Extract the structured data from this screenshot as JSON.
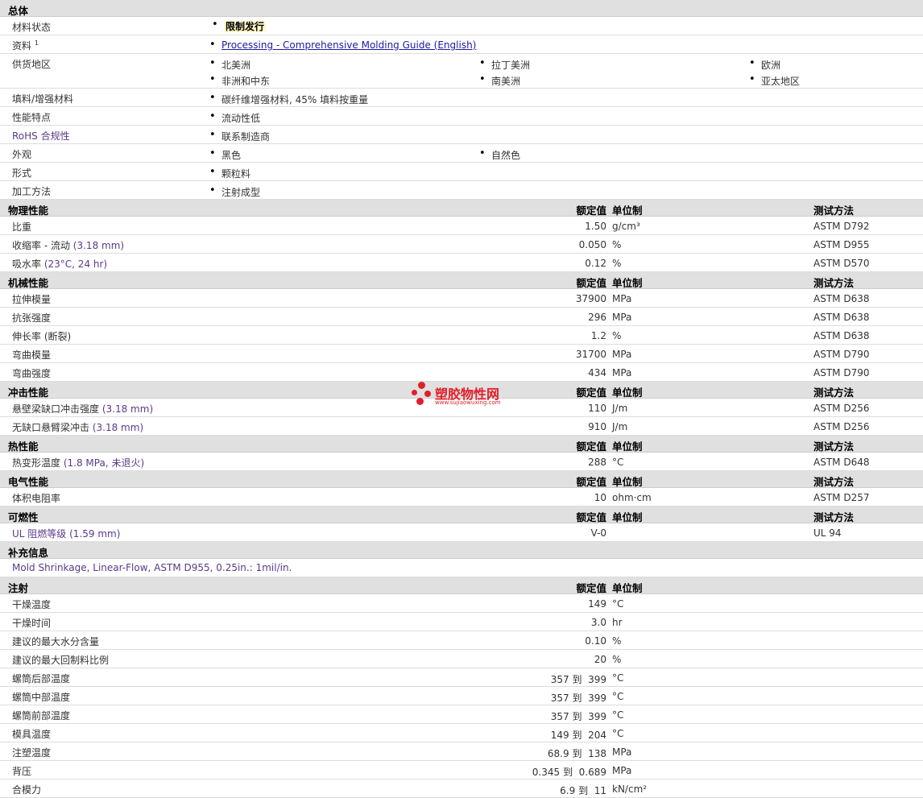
{
  "general": {
    "title": "总体",
    "rows": [
      {
        "label": "材料状态",
        "values": [
          "限制发行"
        ]
      },
      {
        "label": "资料",
        "sup": "1",
        "link": "Processing - Comprehensive Molding Guide (English)"
      },
      {
        "label": "供货地区",
        "regions": [
          "北美洲",
          "拉丁美洲",
          "欧洲",
          "非洲和中东",
          "南美洲",
          "亚太地区"
        ]
      },
      {
        "label": "填料/增强材料",
        "values": [
          "碳纤维增强材料, 45% 填料按重量"
        ]
      },
      {
        "label": "性能特点",
        "values": [
          "流动性低"
        ]
      },
      {
        "label": "RoHS 合规性",
        "values": [
          "联系制造商"
        ]
      },
      {
        "label": "外观",
        "values": [
          "黑色",
          "自然色"
        ]
      },
      {
        "label": "形式",
        "values": [
          "颗粒料"
        ]
      },
      {
        "label": "加工方法",
        "values": [
          "注射成型"
        ]
      }
    ]
  },
  "headers": {
    "value": "额定值",
    "unit": "单位制",
    "method": "测试方法"
  },
  "physical": {
    "title": "物理性能",
    "rows": [
      {
        "label": "比重",
        "note": "",
        "value": "1.50",
        "unit": "g/cm³",
        "method": "ASTM D792"
      },
      {
        "label": "收缩率 - 流动",
        "note": "(3.18 mm)",
        "value": "0.050",
        "unit": "%",
        "method": "ASTM D955"
      },
      {
        "label": "吸水率",
        "note": "(23°C, 24 hr)",
        "value": "0.12",
        "unit": "%",
        "method": "ASTM D570"
      }
    ]
  },
  "mechanical": {
    "title": "机械性能",
    "rows": [
      {
        "label": "拉伸模量",
        "note": "",
        "value": "37900",
        "unit": "MPa",
        "method": "ASTM D638"
      },
      {
        "label": "抗张强度",
        "note": "",
        "value": "296",
        "unit": "MPa",
        "method": "ASTM D638"
      },
      {
        "label": "伸长率",
        "note": "(断裂)",
        "value": "1.2",
        "unit": "%",
        "method": "ASTM D638"
      },
      {
        "label": "弯曲模量",
        "note": "",
        "value": "31700",
        "unit": "MPa",
        "method": "ASTM D790"
      },
      {
        "label": "弯曲强度",
        "note": "",
        "value": "434",
        "unit": "MPa",
        "method": "ASTM D790"
      }
    ]
  },
  "impact": {
    "title": "冲击性能",
    "rows": [
      {
        "label": "悬壁梁缺口冲击强度",
        "note": "(3.18 mm)",
        "value": "110",
        "unit": "J/m",
        "method": "ASTM D256"
      },
      {
        "label": "无缺口悬臂梁冲击",
        "note": "(3.18 mm)",
        "value": "910",
        "unit": "J/m",
        "method": "ASTM D256"
      }
    ]
  },
  "thermal": {
    "title": "热性能",
    "rows": [
      {
        "label": "热变形温度",
        "note": "(1.8 MPa, 未退火)",
        "value": "288",
        "unit": "°C",
        "method": "ASTM D648"
      }
    ]
  },
  "electrical": {
    "title": "电气性能",
    "rows": [
      {
        "label": "体积电阻率",
        "note": "",
        "value": "10",
        "unit": "ohm·cm",
        "method": "ASTM D257"
      }
    ]
  },
  "flammability": {
    "title": "可燃性",
    "rows": [
      {
        "label": "UL 阻燃等级",
        "note": "(1.59 mm)",
        "value": "V-0",
        "unit": "",
        "method": "UL 94"
      }
    ]
  },
  "supplement": {
    "title": "补充信息",
    "text": "Mold Shrinkage, Linear-Flow, ASTM D955, 0.25in.: 1mil/in."
  },
  "injection": {
    "title": "注射",
    "to": "到",
    "rows": [
      {
        "label": "干燥温度",
        "value": "149",
        "unit": "°C"
      },
      {
        "label": "干燥时间",
        "value": "3.0",
        "unit": "hr"
      },
      {
        "label": "建议的最大水分含量",
        "value": "0.10",
        "unit": "%"
      },
      {
        "label": "建议的最大回制料比例",
        "value": "20",
        "unit": "%"
      },
      {
        "label": "螺筒后部温度",
        "from": "357",
        "value": "399",
        "unit": "°C"
      },
      {
        "label": "螺筒中部温度",
        "from": "357",
        "value": "399",
        "unit": "°C"
      },
      {
        "label": "螺筒前部温度",
        "from": "357",
        "value": "399",
        "unit": "°C"
      },
      {
        "label": "模具温度",
        "from": "149",
        "value": "204",
        "unit": "°C"
      },
      {
        "label": "注塑温度",
        "from": "68.9",
        "value": "138",
        "unit": "MPa"
      },
      {
        "label": "背压",
        "from": "0.345",
        "value": "0.689",
        "unit": "MPa"
      },
      {
        "label": "合模力",
        "from": "6.9",
        "value": "11",
        "unit": "kN/cm²"
      }
    ]
  },
  "watermark": {
    "name": "塑胶物性网",
    "url": "www.sujiaowuxing.com",
    "color": "#e0202a"
  }
}
